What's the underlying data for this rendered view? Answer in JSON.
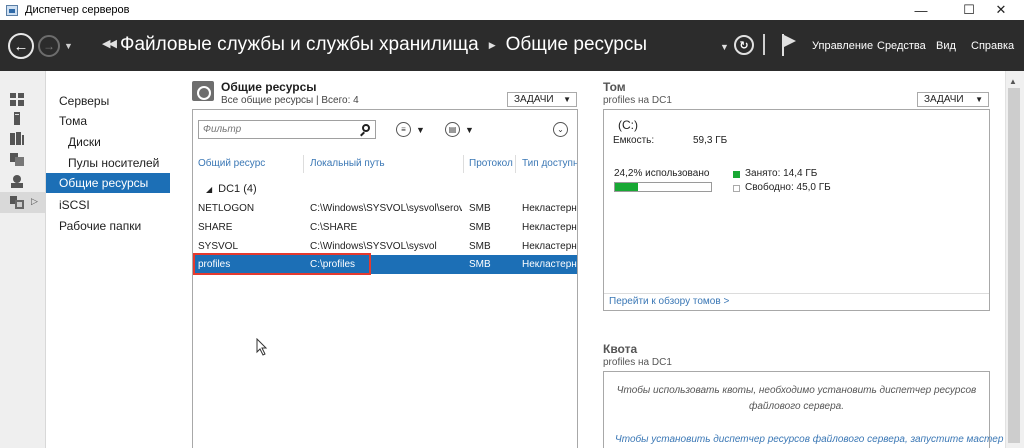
{
  "window": {
    "title": "Диспетчер серверов",
    "minimize": "—",
    "maximize": "☐",
    "close": "✕"
  },
  "header": {
    "breadcrumb_parent": "Файловые службы и службы хранилища",
    "breadcrumb_current": "Общие ресурсы",
    "menu": [
      "Управление",
      "Средства",
      "Вид",
      "Справка"
    ]
  },
  "leftnav": {
    "items": [
      {
        "label": "Серверы"
      },
      {
        "label": "Тома"
      },
      {
        "label": "Диски"
      },
      {
        "label": "Пулы носителей"
      },
      {
        "label": "Общие ресурсы"
      },
      {
        "label": "iSCSI"
      },
      {
        "label": "Рабочие папки"
      }
    ],
    "selected": "Общие ресурсы"
  },
  "shares": {
    "title": "Общие ресурсы",
    "subtitle": "Все общие ресурсы | Всего: 4",
    "tasks_label": "ЗАДАЧИ",
    "filter_placeholder": "Фильтр",
    "columns": [
      "Общий ресурс",
      "Локальный путь",
      "Протокол",
      "Тип доступн"
    ],
    "group_label": "DC1 (4)",
    "rows": [
      {
        "name": "NETLOGON",
        "path": "C:\\Windows\\SYSVOL\\sysvol\\serov...",
        "protocol": "SMB",
        "type": "Некластерны"
      },
      {
        "name": "SHARE",
        "path": "C:\\SHARE",
        "protocol": "SMB",
        "type": "Некластерны"
      },
      {
        "name": "SYSVOL",
        "path": "C:\\Windows\\SYSVOL\\sysvol",
        "protocol": "SMB",
        "type": "Некластерны"
      },
      {
        "name": "profiles",
        "path": "C:\\profiles",
        "protocol": "SMB",
        "type": "Некластерны"
      }
    ],
    "selected_row": "profiles"
  },
  "volume": {
    "title": "Том",
    "subtitle": "profiles на DC1",
    "tasks_label": "ЗАДАЧИ",
    "drive": "(C:)",
    "capacity_label": "Емкость:",
    "capacity_value": "59,3 ГБ",
    "used_text": "24,2% использовано",
    "used_fraction": 0.242,
    "used_legend": "Занято: 14,4 ГБ",
    "free_legend": "Свободно: 45,0 ГБ",
    "link": "Перейти к обзору томов >",
    "used_color": "#18a834"
  },
  "quota": {
    "title": "Квота",
    "subtitle": "profiles на DC1",
    "message_line1": "Чтобы использовать квоты, необходимо установить диспетчер ресурсов",
    "message_line2": "файлового сервера.",
    "link": "Чтобы установить диспетчер ресурсов файлового сервера, запустите мастер"
  },
  "colors": {
    "accent": "#1c6fb6",
    "header_bg": "#2c2c2c",
    "link": "#3a77b5",
    "highlight": "#e53a2e"
  }
}
